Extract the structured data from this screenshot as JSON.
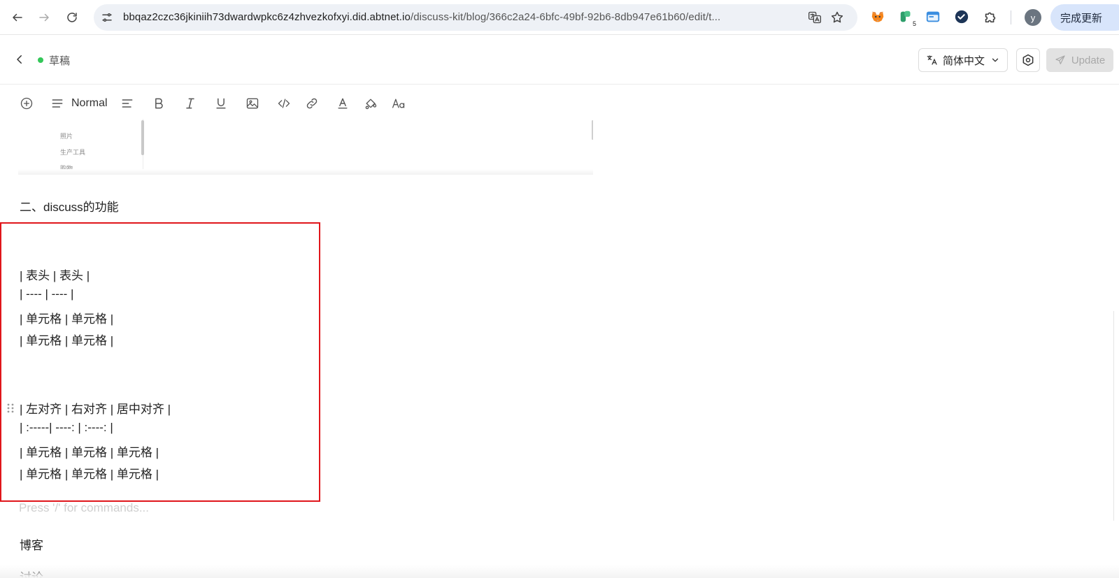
{
  "browser": {
    "url_host": "bbqaz2czc36jkiniih73dwardwpkc6z4zhvezkofxyi.did.abtnet.io",
    "url_path": "/discuss-kit/blog/366c2a24-6bfc-49bf-92b6-8db947e61b60/edit/t...",
    "extension_badge": "5",
    "profile_initial": "y",
    "update_label": "完成更新"
  },
  "header": {
    "status": "草稿",
    "language": "简体中文",
    "publish_label": "Update"
  },
  "toolbar": {
    "block_style": "Normal"
  },
  "embed": {
    "items": [
      "照片",
      "生产工具",
      "购物"
    ]
  },
  "content": {
    "heading": "二、discuss的功能",
    "table1": [
      "| 表头 | 表头 |",
      "| ---- | ---- |",
      "| 单元格 | 单元格 |",
      "| 单元格 | 单元格 |"
    ],
    "table2": [
      "| 左对齐 | 右对齐 | 居中对齐 |",
      "| :-----| ----: | :----: |",
      "| 单元格 | 单元格 | 单元格 |",
      "| 单元格 | 单元格 | 单元格 |"
    ],
    "placeholder": "Press '/' for commands...",
    "after": [
      "博客",
      "讨论"
    ]
  }
}
